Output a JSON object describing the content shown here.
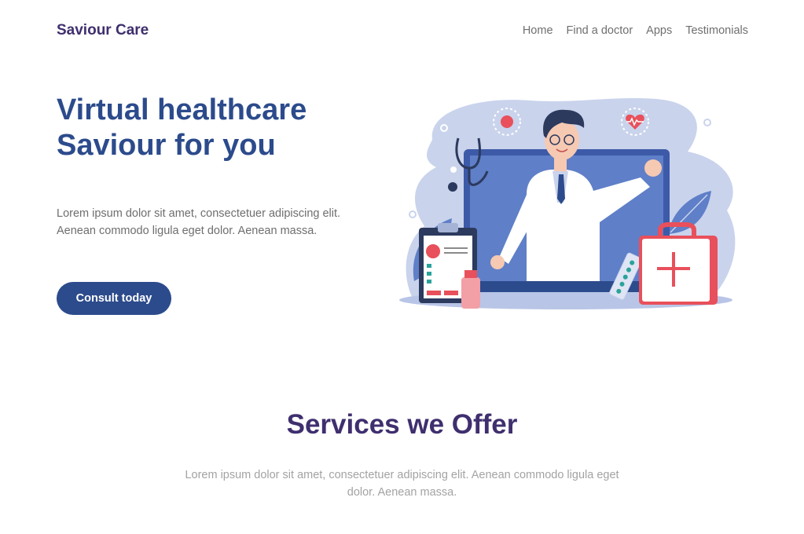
{
  "header": {
    "brand": "Saviour Care",
    "nav": [
      "Home",
      "Find a doctor",
      "Apps",
      "Testimonials"
    ]
  },
  "hero": {
    "title_line1": "Virtual healthcare",
    "title_line2": "Saviour for you",
    "text_line1": "Lorem ipsum dolor sit amet, consectetuer adipiscing elit.",
    "text_line2": "Aenean commodo ligula eget dolor. Aenean massa.",
    "cta_label": "Consult today"
  },
  "services": {
    "title": "Services we Offer",
    "text_line1": "Lorem ipsum dolor sit amet, consectetuer adipiscing elit. Aenean commodo ligula eget",
    "text_line2": "dolor. Aenean massa."
  },
  "colors": {
    "brand_purple": "#3f2f6e",
    "primary_blue": "#2c4b8c",
    "illustration_blob": "#c9d3ec",
    "illustration_screen": "#5f7fc8",
    "accent_red": "#e8505b"
  }
}
